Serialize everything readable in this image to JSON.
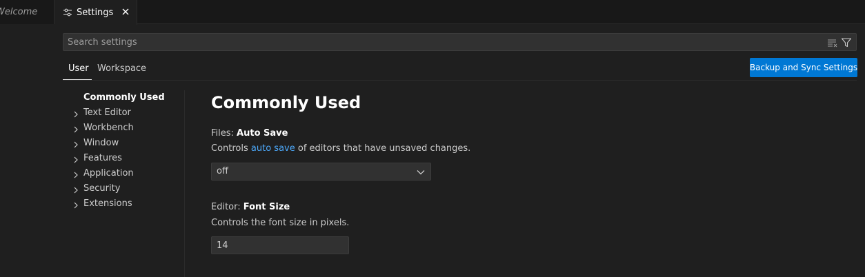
{
  "tabs": {
    "welcome": {
      "label": "Welcome"
    },
    "settings": {
      "label": "Settings",
      "icon": "settings-sliders-icon",
      "close_icon": "close-icon"
    }
  },
  "search": {
    "placeholder": "Search settings",
    "value": "",
    "clear_icon": "clear-filter-icon",
    "filter_icon": "filter-icon"
  },
  "scopes": {
    "user": "User",
    "workspace": "Workspace",
    "active": "User"
  },
  "sync_button": {
    "label": "Backup and Sync Settings",
    "color": "#0078d4"
  },
  "toc": {
    "items": [
      {
        "label": "Commonly Used",
        "active": true,
        "expandable": false
      },
      {
        "label": "Text Editor",
        "active": false,
        "expandable": true
      },
      {
        "label": "Workbench",
        "active": false,
        "expandable": true
      },
      {
        "label": "Window",
        "active": false,
        "expandable": true
      },
      {
        "label": "Features",
        "active": false,
        "expandable": true
      },
      {
        "label": "Application",
        "active": false,
        "expandable": true
      },
      {
        "label": "Security",
        "active": false,
        "expandable": true
      },
      {
        "label": "Extensions",
        "active": false,
        "expandable": true
      }
    ]
  },
  "main": {
    "section_title": "Commonly Used",
    "auto_save": {
      "category": "Files: ",
      "name": "Auto Save",
      "desc_prefix": "Controls ",
      "desc_link": "auto save",
      "desc_suffix": " of editors that have unsaved changes.",
      "value": "off"
    },
    "font_size": {
      "category": "Editor: ",
      "name": "Font Size",
      "desc": "Controls the font size in pixels.",
      "value": "14"
    }
  },
  "colors": {
    "background": "#1f1f1f",
    "link": "#4daafc",
    "accent": "#0078d4"
  }
}
